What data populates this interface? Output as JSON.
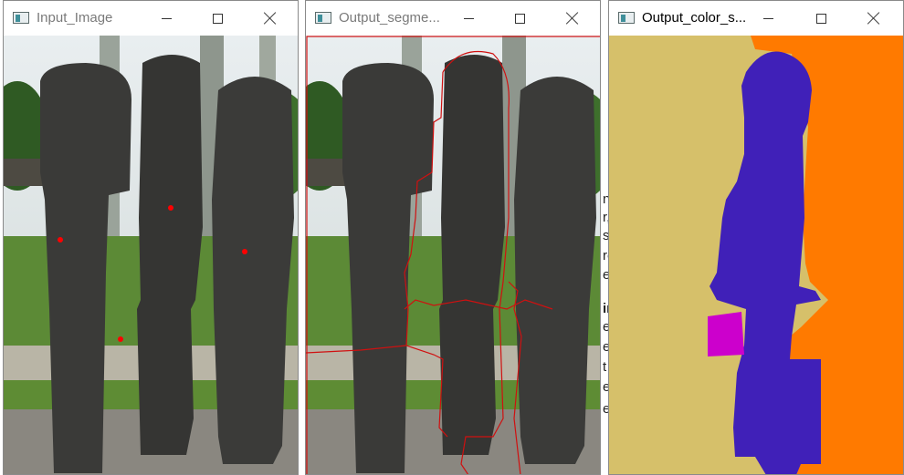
{
  "windows": [
    {
      "title": "Input_Image",
      "active": false
    },
    {
      "title": "Output_segme...",
      "active": false
    },
    {
      "title": "Output_color_s...",
      "active": true
    }
  ],
  "background_text": [
    "n",
    "r,",
    "s",
    "ro",
    "e",
    "ir",
    "e",
    "e",
    "t",
    "e",
    "er"
  ],
  "colors": {
    "segment_beige": "#d6c06a",
    "segment_orange": "#ff7a00",
    "segment_indigo": "#4020b8",
    "segment_magenta": "#cc00cc",
    "seed_red": "#ff0000",
    "boundary_red": "#d01010"
  },
  "icons": [
    "window-app-icon",
    "minimize-icon",
    "maximize-icon",
    "close-icon"
  ]
}
